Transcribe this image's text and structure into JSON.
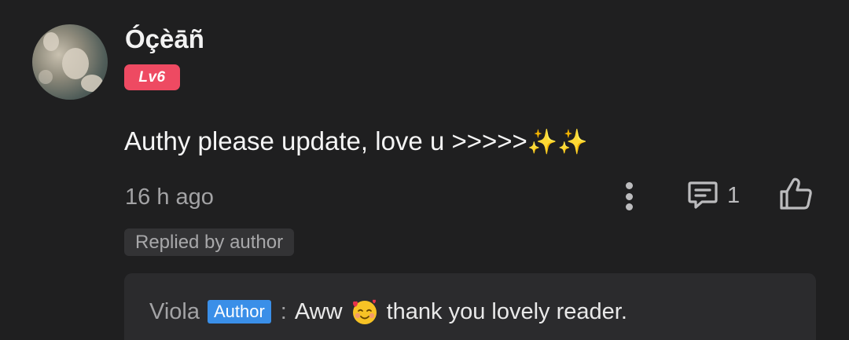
{
  "comment": {
    "username": "Óçèāñ",
    "level": "Lv6",
    "body": "Authy please update, love u >>>>>",
    "body_emoji": "✨✨",
    "timestamp": "16 h ago",
    "reply_count": "1",
    "replied_chip": "Replied by author"
  },
  "reply": {
    "author_name": "Viola",
    "author_badge": "Author",
    "separator": ":",
    "text_before": "Aww",
    "text_after": "thank you lovely reader."
  },
  "icons": {
    "more": "more-vertical-icon",
    "reply": "comment-icon",
    "like": "thumbs-up-icon",
    "emoji": "smiling-face-with-hearts-icon"
  },
  "colors": {
    "background": "#1f1f20",
    "level_badge": "#ee4a62",
    "author_badge": "#3a8fe8",
    "reply_box": "#2b2b2d"
  }
}
